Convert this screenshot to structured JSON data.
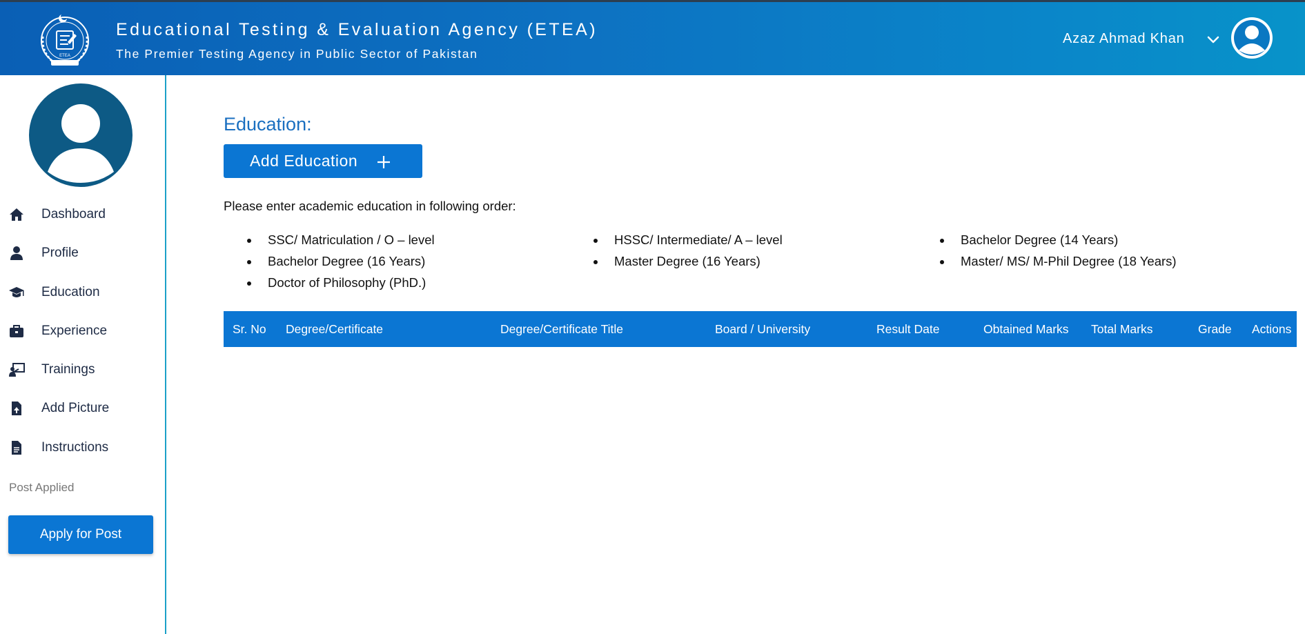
{
  "header": {
    "title": "Educational Testing & Evaluation Agency (ETEA)",
    "subtitle": "The Premier Testing Agency in Public Sector of Pakistan",
    "user_name": "Azaz Ahmad Khan",
    "logo_icon": "etea-crest-logo",
    "avatar_icon": "user-avatar-icon",
    "chevron_icon": "chevron-down-icon"
  },
  "sidebar": {
    "avatar_icon": "profile-avatar-icon",
    "items": [
      {
        "label": "Dashboard",
        "icon": "home-icon"
      },
      {
        "label": "Profile",
        "icon": "user-icon"
      },
      {
        "label": "Education",
        "icon": "graduation-cap-icon"
      },
      {
        "label": "Experience",
        "icon": "briefcase-icon"
      },
      {
        "label": "Trainings",
        "icon": "trainer-icon"
      },
      {
        "label": "Add Picture",
        "icon": "file-upload-icon"
      },
      {
        "label": "Instructions",
        "icon": "document-icon"
      }
    ],
    "post_applied_label": "Post Applied",
    "apply_button": "Apply for Post"
  },
  "main": {
    "title": "Education:",
    "add_button": "Add Education",
    "instructions": "Please enter academic education in following order:",
    "order_list": [
      "SSC/ Matriculation / O – level",
      "HSSC/ Intermediate/ A – level",
      "Bachelor Degree (14 Years)",
      "Bachelor Degree (16 Years)",
      "Master Degree (16 Years)",
      "Master/ MS/ M-Phil Degree (18 Years)",
      "Doctor of Philosophy (PhD.)"
    ],
    "table": {
      "columns": [
        "Sr. No",
        "Degree/Certificate",
        "Degree/Certificate Title",
        "Board / University",
        "Result Date",
        "Obtained Marks",
        "Total Marks",
        "Grade",
        "Actions"
      ],
      "rows": []
    }
  },
  "colors": {
    "header_start": "#0a5fb5",
    "header_end": "#0893c9",
    "primary_button": "#0b76d3",
    "title_blue": "#1a6fc0",
    "sidebar_icon": "#1e2b45",
    "avatar_fill": "#0d5a85"
  }
}
